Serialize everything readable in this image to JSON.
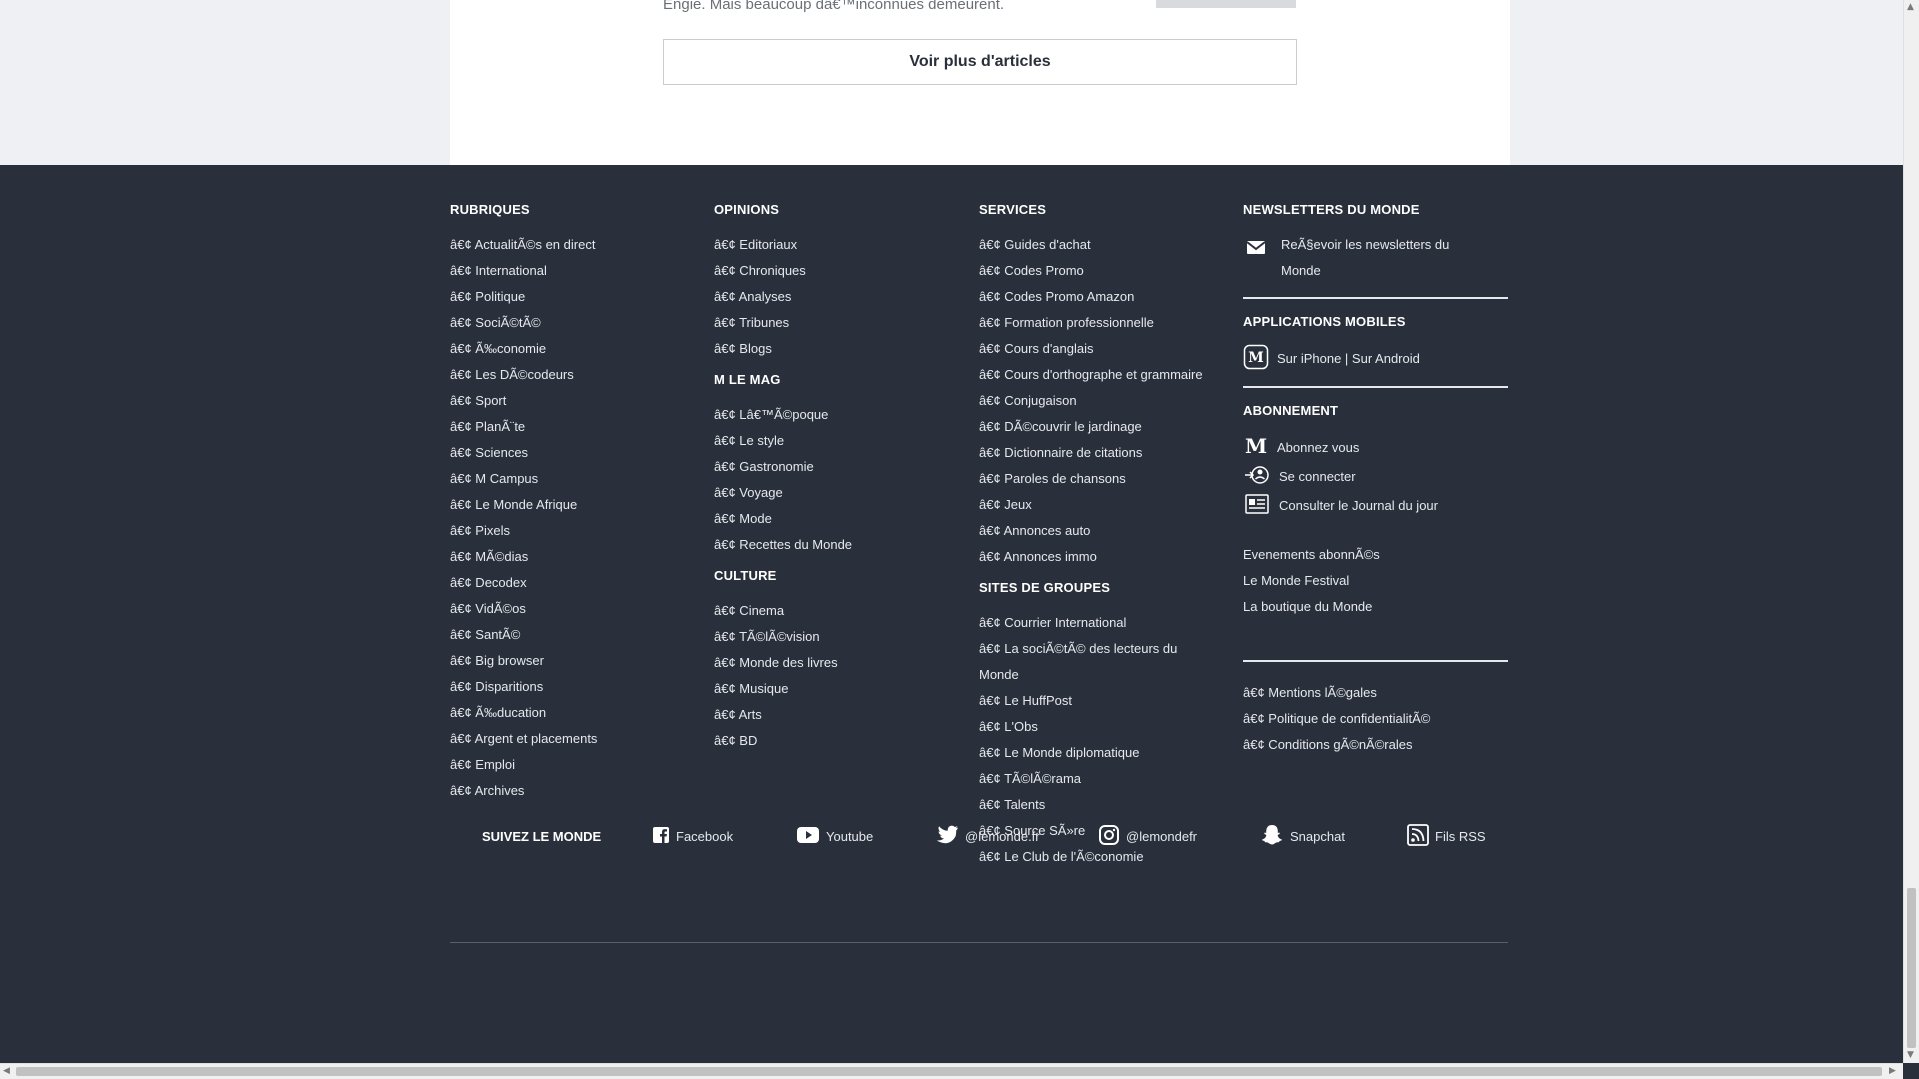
{
  "article": {
    "snippet": "Engie. Mais beaucoup dâ€™inconnues demeurent.",
    "more_button": "Voir plus d'articles"
  },
  "footer": {
    "rubriques": {
      "title": "RUBRIQUES",
      "items": [
        "â€¢ ActualitÃ©s en direct",
        "â€¢ International",
        "â€¢ Politique",
        "â€¢ SociÃ©tÃ©",
        "â€¢ Ã‰conomie",
        "â€¢ Les DÃ©codeurs",
        "â€¢ Sport",
        "â€¢ PlanÃ¨te",
        "â€¢ Sciences",
        "â€¢ M Campus",
        "â€¢ Le Monde Afrique",
        "â€¢ Pixels",
        "â€¢ MÃ©dias",
        "â€¢ Decodex",
        "â€¢ VidÃ©os",
        "â€¢ SantÃ©",
        "â€¢ Big browser",
        "â€¢ Disparitions",
        "â€¢ Ã‰ducation",
        "â€¢ Argent et placements",
        "â€¢ Emploi",
        "â€¢ Archives"
      ]
    },
    "opinions": {
      "title": "OPINIONS",
      "items": [
        "â€¢ Editoriaux",
        "â€¢ Chroniques",
        "â€¢ Analyses",
        "â€¢ Tribunes",
        "â€¢ Blogs"
      ]
    },
    "mlemag": {
      "title": "M LE MAG",
      "items": [
        "â€¢ Lâ€™Ã©poque",
        "â€¢ Le style",
        "â€¢ Gastronomie",
        "â€¢ Voyage",
        "â€¢ Mode",
        "â€¢ Recettes du Monde"
      ]
    },
    "culture": {
      "title": "CULTURE",
      "items": [
        "â€¢ Cinema",
        "â€¢ TÃ©lÃ©vision",
        "â€¢ Monde des livres",
        "â€¢ Musique",
        "â€¢ Arts",
        "â€¢ BD"
      ]
    },
    "services": {
      "title": "SERVICES",
      "items": [
        "â€¢ Guides d'achat",
        "â€¢ Codes Promo",
        "â€¢ Codes Promo Amazon",
        "â€¢ Formation professionnelle",
        "â€¢ Cours d'anglais",
        "â€¢ Cours d'orthographe et grammaire",
        "â€¢ Conjugaison",
        "â€¢ DÃ©couvrir le jardinage",
        "â€¢ Dictionnaire de citations",
        "â€¢ Paroles de chansons",
        "â€¢ Jeux",
        "â€¢ Annonces auto",
        "â€¢ Annonces immo"
      ]
    },
    "sites": {
      "title": "SITES DE GROUPES",
      "items": [
        "â€¢ Courrier International",
        "â€¢ La sociÃ©tÃ© des lecteurs du Monde",
        "â€¢ Le HuffPost",
        "â€¢ L'Obs",
        "â€¢ Le Monde diplomatique",
        "â€¢ TÃ©lÃ©rama",
        "â€¢ Talents",
        "â€¢ Source SÃ»re",
        "â€¢ Le Club de l'Ã©conomie"
      ]
    },
    "newsletters": {
      "title": "NEWSLETTERS DU MONDE",
      "text": "ReÃ§evoir les newsletters du Monde"
    },
    "apps": {
      "title": "APPLICATIONS MOBILES",
      "text": "Sur iPhone | Sur Android"
    },
    "abonnement": {
      "title": "ABONNEMENT",
      "subscribe": "Abonnez vous",
      "login": "Se connecter",
      "journal": "Consulter le Journal du jour"
    },
    "extra_links": [
      "Evenements abonnÃ©s",
      "Le Monde Festival",
      "La boutique du Monde"
    ],
    "legal_links": [
      "â€¢ Mentions lÃ©gales",
      "â€¢ Politique de confidentialitÃ©",
      "â€¢ Conditions gÃ©nÃ©rales"
    ],
    "social": {
      "title": "SUIVEZ LE MONDE",
      "facebook": "Facebook",
      "youtube": "Youtube",
      "twitter": "@lemonde.fr",
      "instagram": "@lemondefr",
      "snapchat": "Snapchat",
      "rss": "Fils RSS"
    }
  },
  "colors": {
    "footer_bg": "#2a303b",
    "page_bg": "#eef0f3",
    "card_bg": "#ffffff",
    "text_light": "#e6e8ec"
  }
}
